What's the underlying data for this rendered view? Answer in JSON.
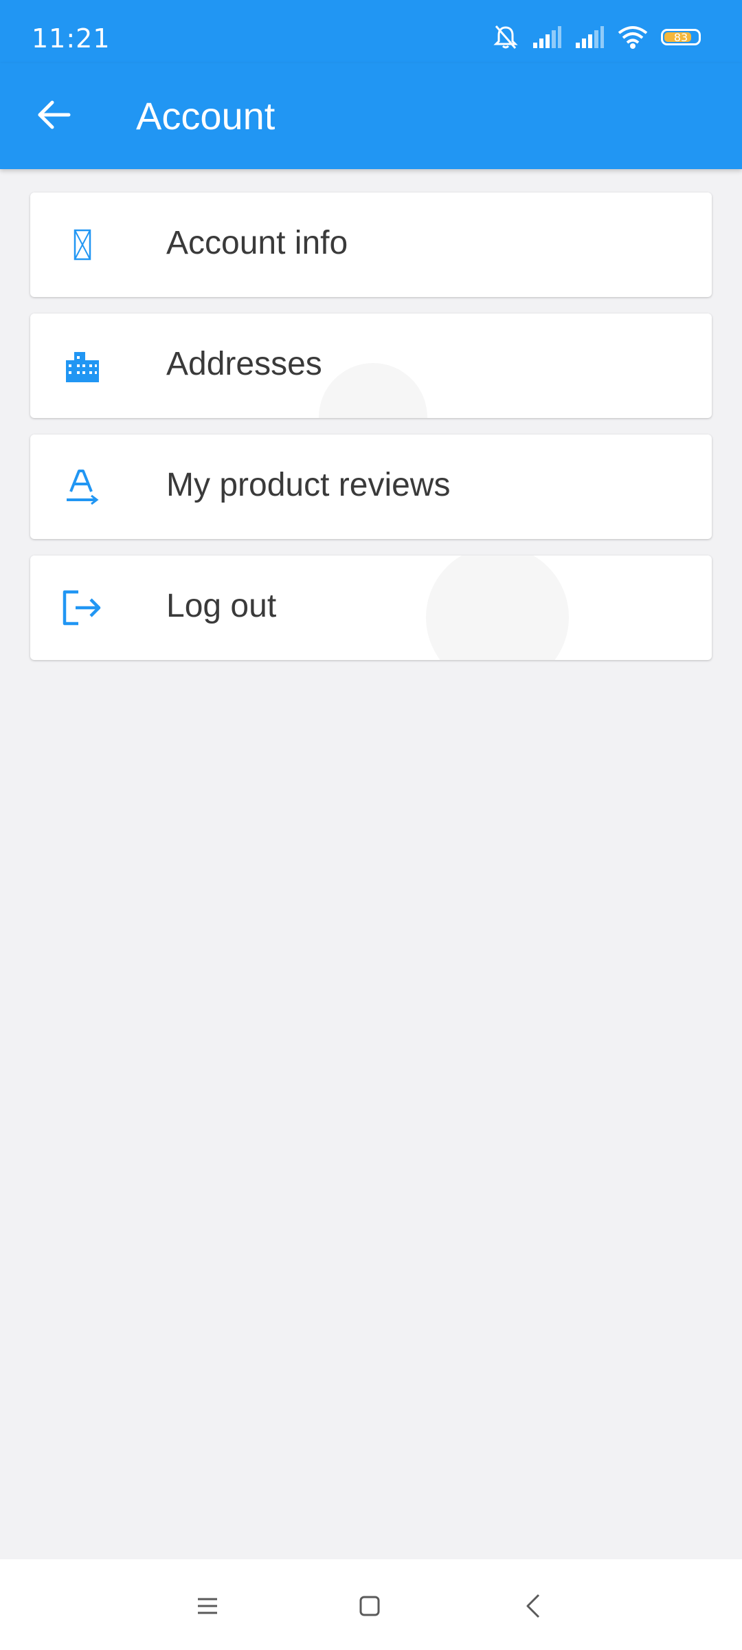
{
  "status_bar": {
    "time": "11:21",
    "battery_text": "83",
    "battery_level": 0.83,
    "icons": [
      "bell-muted-icon",
      "signal-icon",
      "signal-icon",
      "wifi-icon",
      "battery-icon"
    ]
  },
  "app_bar": {
    "title": "Account",
    "back_icon": "arrow-left-icon",
    "background_color": "#2196f3"
  },
  "menu": {
    "items": [
      {
        "label": "Account info",
        "icon": "missing-glyph-icon"
      },
      {
        "label": "Addresses",
        "icon": "building-icon"
      },
      {
        "label": "My product reviews",
        "icon": "text-format-icon"
      },
      {
        "label": "Log out",
        "icon": "logout-icon"
      }
    ],
    "accent_color": "#2196f3"
  },
  "nav_bar": {
    "buttons": [
      "menu-icon",
      "home-square-icon",
      "back-chevron-icon"
    ]
  }
}
